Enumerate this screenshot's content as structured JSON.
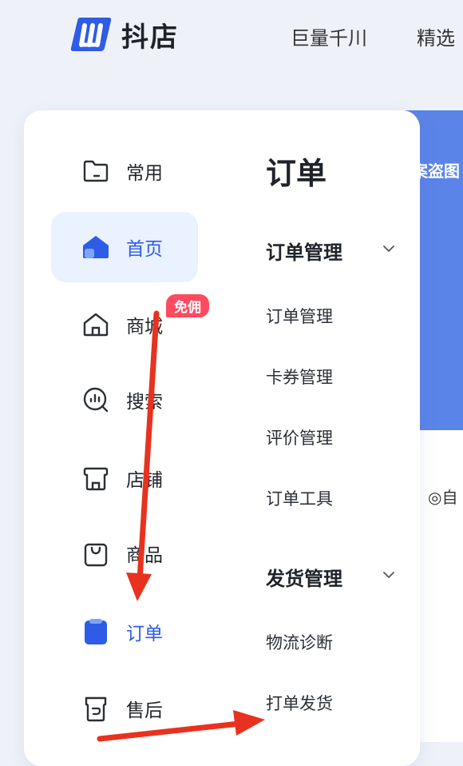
{
  "header": {
    "brand": "抖店",
    "nav": [
      "巨量千川",
      "精选"
    ]
  },
  "banner_text": "案盗图",
  "right_fragment": "◎自",
  "sidebar": {
    "items": [
      {
        "label": "常用",
        "icon": "folder-icon"
      },
      {
        "label": "首页",
        "icon": "home-icon",
        "active": true
      },
      {
        "label": "商城",
        "icon": "mall-icon",
        "badge": "免佣"
      },
      {
        "label": "搜索",
        "icon": "search-icon"
      },
      {
        "label": "店铺",
        "icon": "store-icon"
      },
      {
        "label": "商品",
        "icon": "bag-icon"
      },
      {
        "label": "订单",
        "icon": "order-icon",
        "highlight": true
      },
      {
        "label": "售后",
        "icon": "aftersale-icon"
      }
    ]
  },
  "menu": {
    "title": "订单",
    "groups": [
      {
        "title": "订单管理",
        "items": [
          "订单管理",
          "卡券管理",
          "评价管理",
          "订单工具"
        ]
      },
      {
        "title": "发货管理",
        "items": [
          "物流诊断",
          "打单发货"
        ]
      }
    ]
  },
  "colors": {
    "accent": "#2e5ce6",
    "arrow": "#e8321f",
    "badge": "#ff4a5f"
  }
}
